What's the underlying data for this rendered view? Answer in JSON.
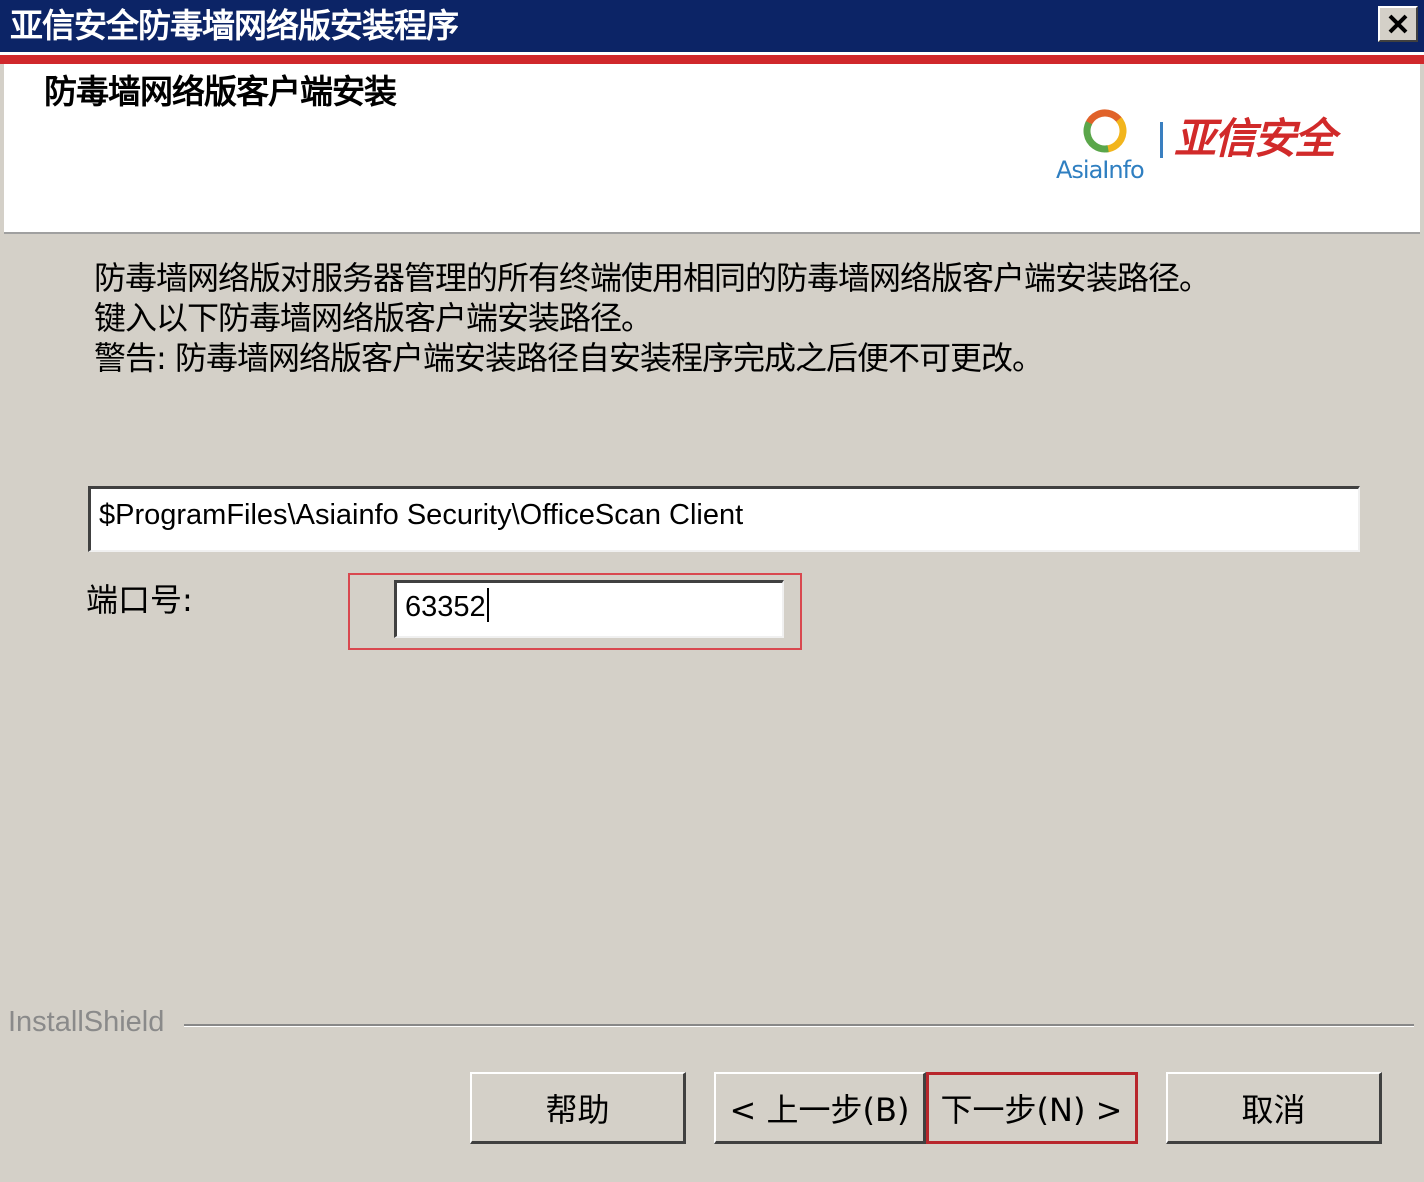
{
  "window": {
    "title": "亚信安全防毒墙网络版安装程序",
    "close_glyph": "✕"
  },
  "banner": {
    "heading": "防毒墙网络版客户端安装",
    "logo_en": "AsiaInfo",
    "logo_cn": "亚信安全",
    "colors": {
      "logo_en": "#2f7fc1",
      "logo_cn": "#d12a2a"
    }
  },
  "description": {
    "line1": "防毒墙网络版对服务器管理的所有终端使用相同的防毒墙网络版客户端安装路径。",
    "line2": "键入以下防毒墙网络版客户端安装路径。",
    "line3": "警告: 防毒墙网络版客户端安装路径自安装程序完成之后便不可更改。"
  },
  "install_path": {
    "value": "$ProgramFiles\\Asiainfo Security\\OfficeScan Client"
  },
  "port": {
    "label": "端口号:",
    "value": "63352"
  },
  "footer": {
    "brand": "InstallShield"
  },
  "buttons": {
    "help": "帮助",
    "back": "< 上一步(B)",
    "next": "下一步(N) >",
    "cancel": "取消"
  },
  "colors": {
    "titlebar": "#0c2466",
    "accent_red": "#d0282c",
    "dialog_bg": "#d4d0c8"
  }
}
